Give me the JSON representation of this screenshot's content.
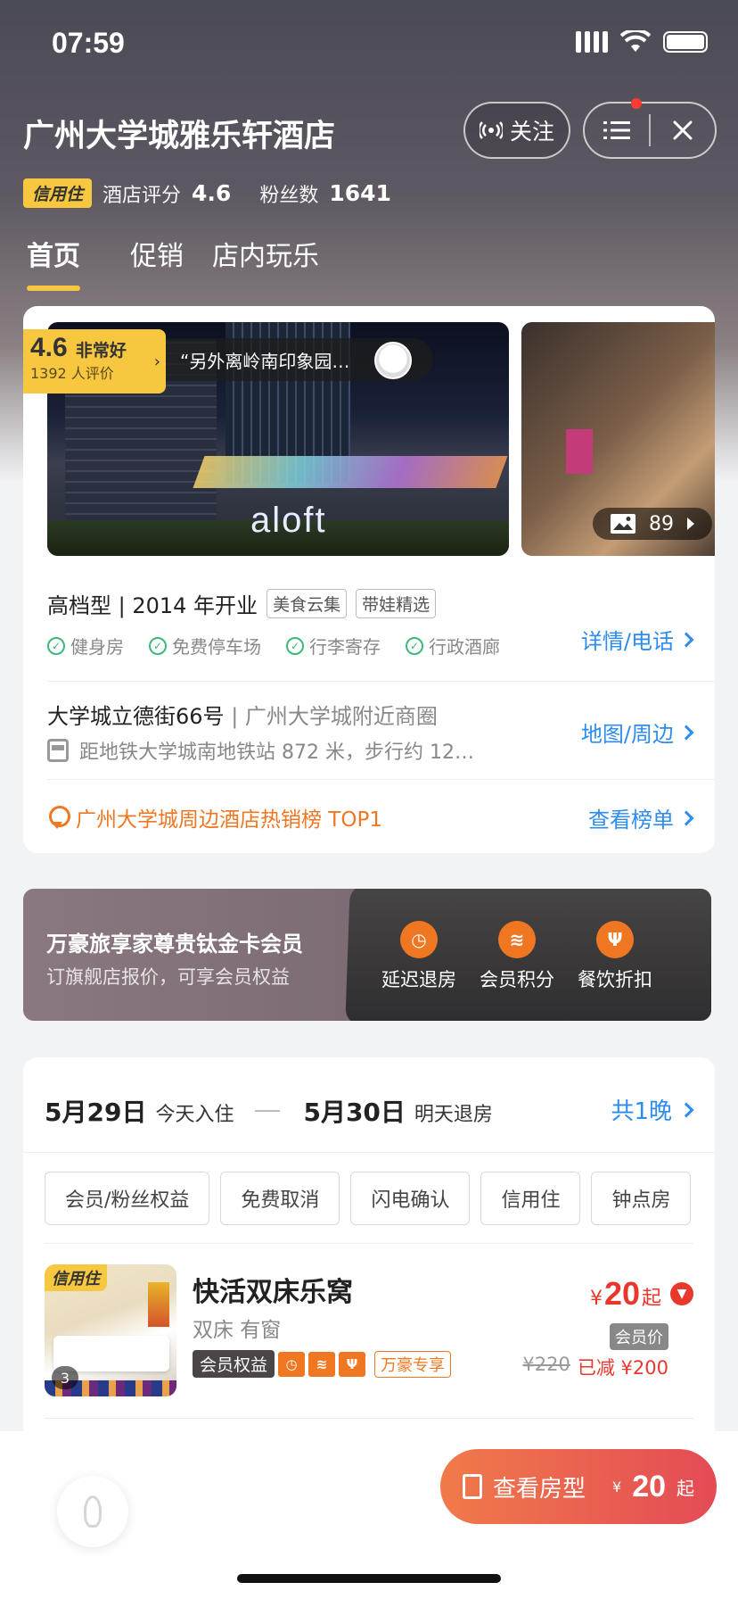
{
  "status": {
    "time": "07:59"
  },
  "header": {
    "title": "广州大学城雅乐轩酒店",
    "follow_label": "关注",
    "credit_badge": "信用住",
    "score_label": "酒店评分",
    "score": "4.6",
    "fans_label": "粉丝数",
    "fans": "1641"
  },
  "tabs": [
    "首页",
    "促销",
    "店内玩乐"
  ],
  "gallery": {
    "rating": "4.6",
    "rating_word": "非常好",
    "review_count": "1392 人评价",
    "quote": "“另外离岭南印象园…",
    "photo_count": "89",
    "main_sign": "aloft"
  },
  "info": {
    "type": "高档型 | 2014 年开业",
    "tags": [
      "美食云集",
      "带娃精选"
    ],
    "facilities": [
      "健身房",
      "免费停车场",
      "行李寄存",
      "行政酒廊"
    ],
    "detail_link": "详情/电话",
    "address": "大学城立德街66号",
    "address_area": "| 广州大学城附近商圈",
    "metro": "距地铁大学城南地铁站 872 米，步行约 12…",
    "map_link": "地图/周边",
    "hot": "广州大学城周边酒店热销榜 TOP1",
    "hot_link": "查看榜单"
  },
  "member": {
    "title": "万豪旅享家尊贵钛金卡会员",
    "subtitle": "订旗舰店报价，可享会员权益",
    "benefits": [
      "延迟退房",
      "会员积分",
      "餐饮折扣"
    ]
  },
  "booking": {
    "checkin_date": "5月29日",
    "checkin_label": "今天入住",
    "checkout_date": "5月30日",
    "checkout_label": "明天退房",
    "nights": "共1晚",
    "filters": [
      "会员/粉丝权益",
      "免费取消",
      "闪电确认",
      "信用住",
      "钟点房"
    ]
  },
  "room": {
    "credit": "信用住",
    "photos": "3",
    "name": "快活双床乐窝",
    "sub": "双床 有窗",
    "member_tag": "会员权益",
    "marriott_tag": "万豪专享",
    "currency": "¥",
    "price": "20",
    "price_suffix": "起",
    "member_price": "会员价",
    "original": "¥220",
    "saving": "已减 ¥200"
  },
  "bottom": {
    "view_label": "查看房型",
    "currency": "¥",
    "price": "20",
    "suffix": "起"
  }
}
